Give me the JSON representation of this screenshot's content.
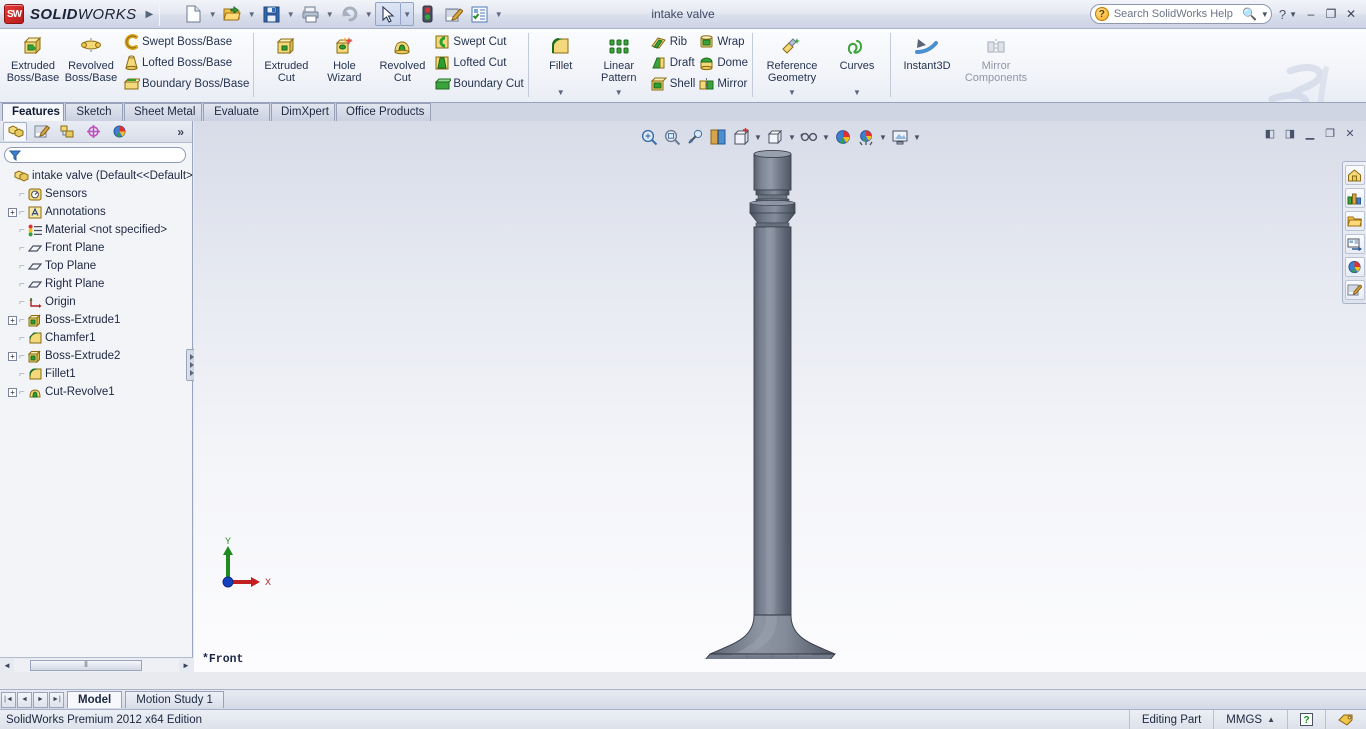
{
  "window": {
    "brand": "SOLIDWORKS",
    "brand_bold": "SOLID",
    "brand_light": "WORKS",
    "document_title": "intake valve",
    "minimize_label": "–",
    "restore_label": "❐",
    "close_label": "✕",
    "help_label": "?",
    "brand_menu_arrow": "▶"
  },
  "quick_access": [
    {
      "name": "new-document",
      "label": "New",
      "has_dropdown": true
    },
    {
      "name": "open-document",
      "label": "Open",
      "has_dropdown": true
    },
    {
      "name": "save-document",
      "label": "Save",
      "has_dropdown": true
    },
    {
      "name": "print-document",
      "label": "Print",
      "has_dropdown": true
    },
    {
      "name": "undo",
      "label": "Undo",
      "has_dropdown": true
    },
    {
      "name": "select",
      "label": "Select",
      "has_dropdown": true
    },
    {
      "name": "rebuild",
      "label": "Rebuild",
      "has_dropdown": false
    },
    {
      "name": "file-properties",
      "label": "File Properties",
      "has_dropdown": false
    },
    {
      "name": "options",
      "label": "Options",
      "has_dropdown": true
    }
  ],
  "search": {
    "placeholder": "Search SolidWorks Help",
    "value": "",
    "icon": "help-orb-icon",
    "magnifier_icon": "magnifier-icon"
  },
  "ribbon": {
    "groups": [
      {
        "name": "boss-base",
        "big": [
          {
            "label_line1": "Extruded",
            "label_line2": "Boss/Base",
            "icon": "extruded-boss-icon",
            "dropdown": false
          },
          {
            "label_line1": "Revolved",
            "label_line2": "Boss/Base",
            "icon": "revolved-boss-icon",
            "dropdown": false
          }
        ],
        "small": [
          {
            "label": "Swept Boss/Base",
            "icon": "swept-boss-icon"
          },
          {
            "label": "Lofted Boss/Base",
            "icon": "lofted-boss-icon"
          },
          {
            "label": "Boundary Boss/Base",
            "icon": "boundary-boss-icon"
          }
        ]
      },
      {
        "name": "cut",
        "big": [
          {
            "label_line1": "Extruded",
            "label_line2": "Cut",
            "icon": "extruded-cut-icon",
            "dropdown": false
          },
          {
            "label_line1": "Hole",
            "label_line2": "Wizard",
            "icon": "hole-wizard-icon",
            "dropdown": false
          },
          {
            "label_line1": "Revolved",
            "label_line2": "Cut",
            "icon": "revolved-cut-icon",
            "dropdown": false
          }
        ],
        "small": [
          {
            "label": "Swept Cut",
            "icon": "swept-cut-icon"
          },
          {
            "label": "Lofted Cut",
            "icon": "lofted-cut-icon"
          },
          {
            "label": "Boundary Cut",
            "icon": "boundary-cut-icon"
          }
        ]
      },
      {
        "name": "features",
        "big": [
          {
            "label_line1": "Fillet",
            "label_line2": "",
            "icon": "fillet-icon",
            "dropdown": true
          },
          {
            "label_line1": "Linear",
            "label_line2": "Pattern",
            "icon": "linear-pattern-icon",
            "dropdown": true
          }
        ],
        "small": [
          {
            "label": "Rib",
            "icon": "rib-icon"
          },
          {
            "label": "Draft",
            "icon": "draft-icon"
          },
          {
            "label": "Shell",
            "icon": "shell-icon"
          }
        ],
        "small2": [
          {
            "label": "Wrap",
            "icon": "wrap-icon"
          },
          {
            "label": "Dome",
            "icon": "dome-icon"
          },
          {
            "label": "Mirror",
            "icon": "mirror-icon"
          }
        ]
      },
      {
        "name": "reference",
        "big": [
          {
            "label_line1": "Reference",
            "label_line2": "Geometry",
            "icon": "reference-geometry-icon",
            "dropdown": true
          },
          {
            "label_line1": "Curves",
            "label_line2": "",
            "icon": "curves-icon",
            "dropdown": true
          }
        ]
      },
      {
        "name": "instant3d",
        "big": [
          {
            "label_line1": "Instant3D",
            "label_line2": "",
            "icon": "instant3d-icon",
            "dropdown": false
          },
          {
            "label_line1": "Mirror",
            "label_line2": "Components",
            "icon": "mirror-components-icon",
            "dropdown": false,
            "disabled": true
          }
        ]
      }
    ]
  },
  "command_tabs": [
    {
      "label": "Features",
      "active": true
    },
    {
      "label": "Sketch",
      "active": false
    },
    {
      "label": "Sheet Metal",
      "active": false
    },
    {
      "label": "Evaluate",
      "active": false
    },
    {
      "label": "DimXpert",
      "active": false
    },
    {
      "label": "Office Products",
      "active": false
    }
  ],
  "left_panel": {
    "tabs": [
      {
        "name": "feature-manager-tab",
        "icon": "feature-tree-icon",
        "active": true
      },
      {
        "name": "property-manager-tab",
        "icon": "property-manager-icon",
        "active": false
      },
      {
        "name": "configuration-manager-tab",
        "icon": "configuration-icon",
        "active": false
      },
      {
        "name": "dimxpert-manager-tab",
        "icon": "dimxpert-icon",
        "active": false
      },
      {
        "name": "display-manager-tab",
        "icon": "display-manager-icon",
        "active": false
      }
    ],
    "more_label": "»",
    "filter": {
      "placeholder": "",
      "value": "",
      "icon": "filter-funnel-icon"
    },
    "tree": [
      {
        "label": "intake valve  (Default<<Default>",
        "icon": "part-icon",
        "expand": "none",
        "level": 0
      },
      {
        "label": "Sensors",
        "icon": "sensors-icon",
        "expand": "none",
        "level": 1
      },
      {
        "label": "Annotations",
        "icon": "annotations-icon",
        "expand": "plus",
        "level": 1
      },
      {
        "label": "Material <not specified>",
        "icon": "material-icon",
        "expand": "none",
        "level": 1
      },
      {
        "label": "Front Plane",
        "icon": "plane-icon",
        "expand": "none",
        "level": 1
      },
      {
        "label": "Top Plane",
        "icon": "plane-icon",
        "expand": "none",
        "level": 1
      },
      {
        "label": "Right Plane",
        "icon": "plane-icon",
        "expand": "none",
        "level": 1
      },
      {
        "label": "Origin",
        "icon": "origin-icon",
        "expand": "none",
        "level": 1
      },
      {
        "label": "Boss-Extrude1",
        "icon": "boss-extrude-icon",
        "expand": "plus",
        "level": 1
      },
      {
        "label": "Chamfer1",
        "icon": "chamfer-icon",
        "expand": "none",
        "level": 1
      },
      {
        "label": "Boss-Extrude2",
        "icon": "boss-extrude-icon",
        "expand": "plus",
        "level": 1
      },
      {
        "label": "Fillet1",
        "icon": "fillet-tree-icon",
        "expand": "none",
        "level": 1
      },
      {
        "label": "Cut-Revolve1",
        "icon": "cut-revolve-icon",
        "expand": "plus",
        "level": 1
      }
    ],
    "hscroll": {
      "left_arrow": "◄",
      "right_arrow": "►",
      "thumb_glyph": "⦀"
    }
  },
  "view_toolbar": [
    {
      "name": "zoom-to-fit-button",
      "icon": "zoom-fit-icon",
      "dropdown": false
    },
    {
      "name": "zoom-to-area-button",
      "icon": "zoom-area-icon",
      "dropdown": false
    },
    {
      "name": "previous-view-button",
      "icon": "previous-view-icon",
      "dropdown": false
    },
    {
      "name": "section-view-button",
      "icon": "section-view-icon",
      "dropdown": false
    },
    {
      "name": "view-orientation-button",
      "icon": "view-orientation-icon",
      "dropdown": true
    },
    {
      "name": "display-style-button",
      "icon": "display-style-icon",
      "dropdown": true
    },
    {
      "name": "hide-show-items-button",
      "icon": "hide-show-icon",
      "dropdown": true
    },
    {
      "name": "edit-appearance-button",
      "icon": "appearance-icon",
      "dropdown": false
    },
    {
      "name": "apply-scene-button",
      "icon": "scene-icon",
      "dropdown": true
    },
    {
      "name": "view-settings-button",
      "icon": "view-settings-icon",
      "dropdown": true
    }
  ],
  "doc_window_controls": [
    {
      "name": "restore-left-button",
      "glyph": "◧"
    },
    {
      "name": "restore-right-button",
      "glyph": "◨"
    },
    {
      "name": "doc-minimize-button",
      "glyph": "▁"
    },
    {
      "name": "doc-restore-button",
      "glyph": "❐"
    },
    {
      "name": "doc-close-button",
      "glyph": "✕"
    }
  ],
  "task_pane": [
    {
      "name": "solidworks-resources-tab",
      "icon": "home-icon"
    },
    {
      "name": "design-library-tab",
      "icon": "design-library-icon"
    },
    {
      "name": "file-explorer-tab",
      "icon": "folder-icon"
    },
    {
      "name": "view-palette-tab",
      "icon": "view-palette-icon"
    },
    {
      "name": "appearances-scenes-tab",
      "icon": "appearances-icon"
    },
    {
      "name": "custom-properties-tab",
      "icon": "custom-properties-icon"
    }
  ],
  "graphics": {
    "view_label": "*Front",
    "triad": {
      "x_label": "X",
      "y_label": "Y"
    },
    "model_name": "intake-valve-part"
  },
  "bottom_tabs": {
    "nav": [
      "|◄",
      "◄",
      "►",
      "►|"
    ],
    "tabs": [
      {
        "label": "Model",
        "active": true
      },
      {
        "label": "Motion Study 1",
        "active": false
      }
    ]
  },
  "status_bar": {
    "left_text": "SolidWorks Premium 2012 x64 Edition",
    "editing_state": "Editing Part",
    "units": "MMGS",
    "units_caret": "▲",
    "help_glyph": "?",
    "tag_icon": "tag-icon"
  },
  "colors": {
    "accent_blue": "#3d6ea8",
    "model_steel": "#6b7383",
    "title_text": "#3c4a63",
    "red_axis": "#cc0000",
    "green_axis": "#008000"
  }
}
